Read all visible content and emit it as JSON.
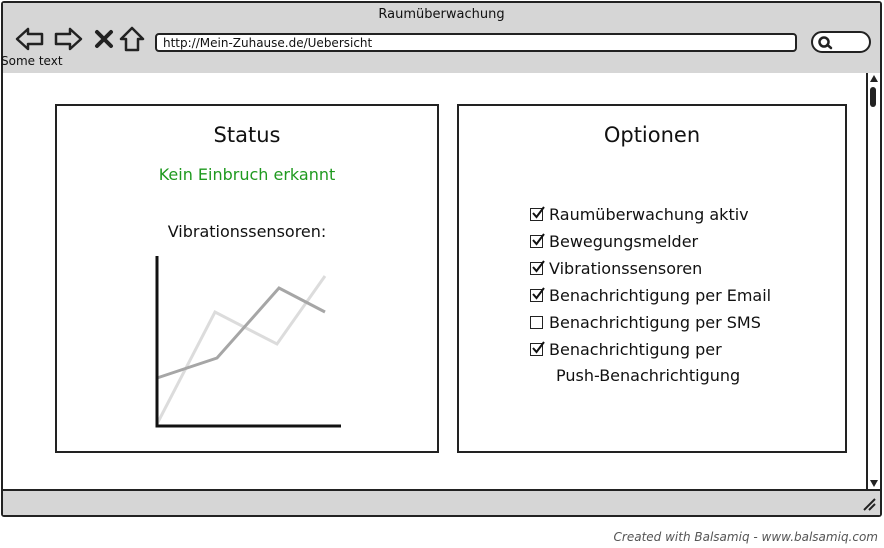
{
  "window": {
    "title": "Raumüberwachung"
  },
  "toolbar": {
    "url": "http://Mein-Zuhause.de/Uebersicht",
    "caption": "Some text"
  },
  "status_panel": {
    "title": "Status",
    "message": "Kein Einbruch erkannt",
    "message_color": "#1f9a1f",
    "sensor_label": "Vibrationssensoren:"
  },
  "options_panel": {
    "title": "Optionen",
    "items": [
      {
        "label": "Raumüberwachung aktiv",
        "checked": true
      },
      {
        "label": "Bewegungsmelder",
        "checked": true
      },
      {
        "label": "Vibrationssensoren",
        "checked": true
      },
      {
        "label": "Benachrichtigung per Email",
        "checked": true
      },
      {
        "label": "Benachrichtigung per SMS",
        "checked": false
      },
      {
        "label": "Benachrichtigung per",
        "label2": "Push-Benachrichtigung",
        "checked": true
      }
    ]
  },
  "footer": {
    "credit": "Created with Balsamiq - www.balsamiq.com"
  }
}
